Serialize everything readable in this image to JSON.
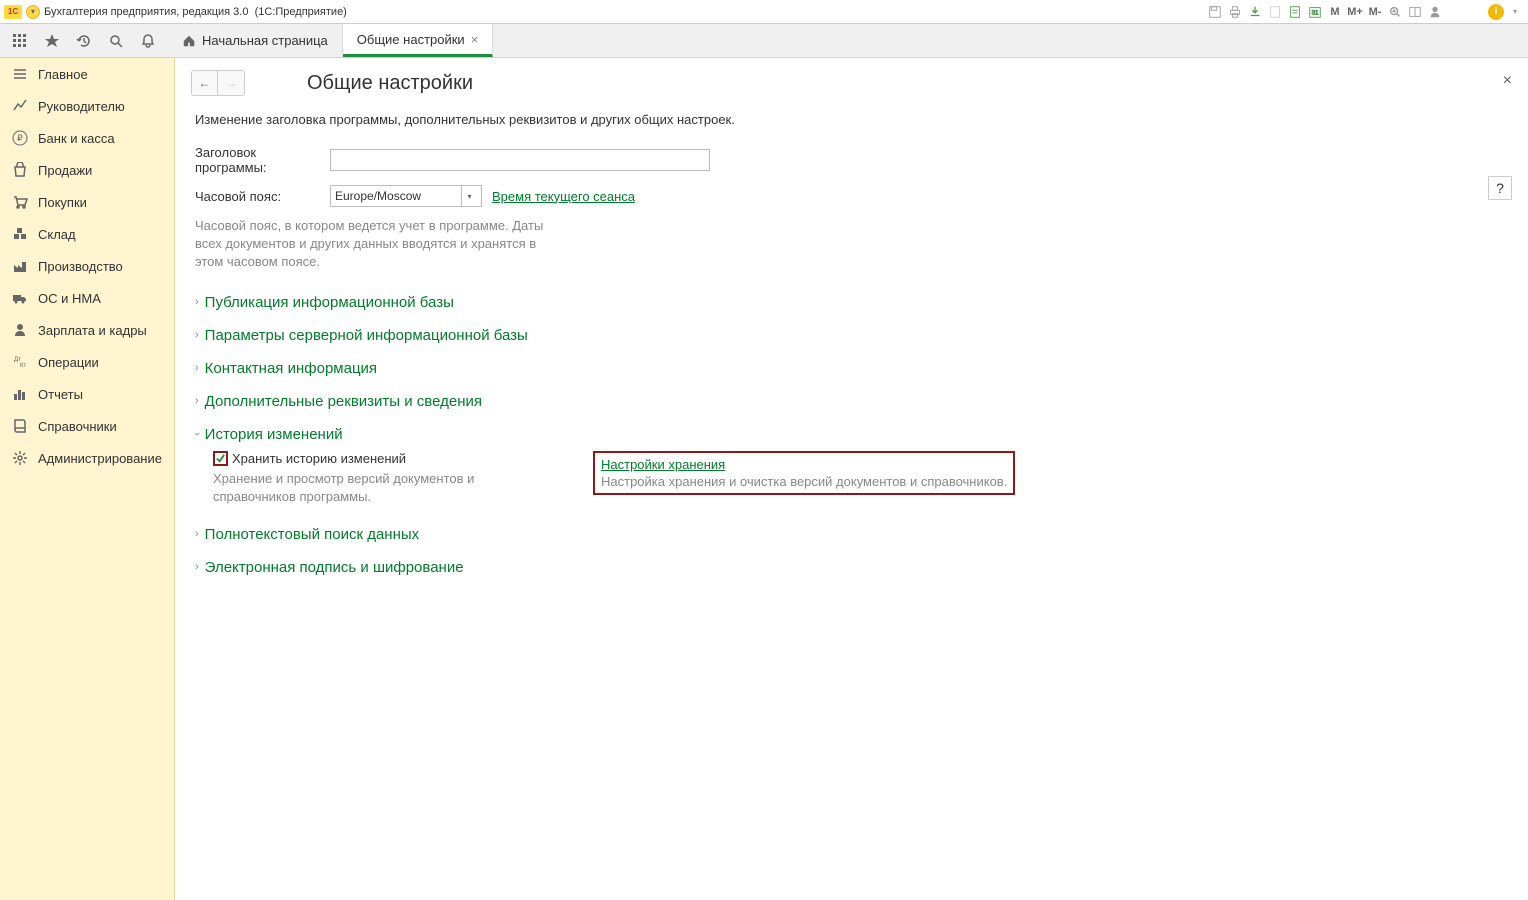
{
  "title_bar": {
    "app_name": "Бухгалтерия предприятия, редакция 3.0",
    "app_mode": "(1С:Предприятие)",
    "m_label": "М",
    "m_plus": "М+",
    "m_minus": "М-"
  },
  "tabs": {
    "home": "Начальная страница",
    "settings": "Общие настройки"
  },
  "sidebar": {
    "items": [
      {
        "label": "Главное"
      },
      {
        "label": "Руководителю"
      },
      {
        "label": "Банк и касса"
      },
      {
        "label": "Продажи"
      },
      {
        "label": "Покупки"
      },
      {
        "label": "Склад"
      },
      {
        "label": "Производство"
      },
      {
        "label": "ОС и НМА"
      },
      {
        "label": "Зарплата и кадры"
      },
      {
        "label": "Операции"
      },
      {
        "label": "Отчеты"
      },
      {
        "label": "Справочники"
      },
      {
        "label": "Администрирование"
      }
    ]
  },
  "page": {
    "title": "Общие настройки",
    "description": "Изменение заголовка программы, дополнительных реквизитов и других общих настроек.",
    "program_title_label": "Заголовок программы:",
    "program_title_value": "",
    "timezone_label": "Часовой пояс:",
    "timezone_value": "Europe/Moscow",
    "session_time_link": "Время текущего сеанса",
    "timezone_hint": "Часовой пояс, в котором ведется учет в программе. Даты всех документов и других данных вводятся и хранятся в этом часовом поясе.",
    "help_label": "?"
  },
  "sections": {
    "publication": "Публикация информационной базы",
    "server_params": "Параметры серверной информационной базы",
    "contact_info": "Контактная информация",
    "additional_req": "Дополнительные реквизиты и сведения",
    "history": {
      "title": "История изменений",
      "checkbox_label": "Хранить историю изменений",
      "checkbox_hint": "Хранение и просмотр версий документов и справочников программы.",
      "storage_link": "Настройки хранения",
      "storage_desc": "Настройка хранения и очистка версий документов и справочников."
    },
    "fulltext": "Полнотекстовый поиск данных",
    "signature": "Электронная подпись и шифрование"
  }
}
